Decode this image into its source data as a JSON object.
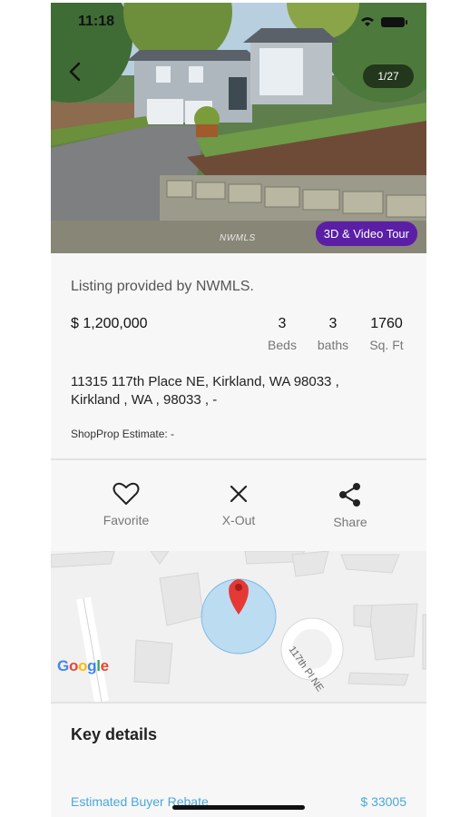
{
  "status_bar": {
    "time": "11:18"
  },
  "gallery": {
    "counter": "1/27",
    "tour_button": "3D & Video Tour",
    "watermark": "NWMLS"
  },
  "listing": {
    "provider": "Listing provided by NWMLS.",
    "price": "$ 1,200,000",
    "stats": [
      {
        "value": "3",
        "label": "Beds"
      },
      {
        "value": "3",
        "label": "baths"
      },
      {
        "value": "1760",
        "label": "Sq. Ft"
      }
    ],
    "address_line1": "11315 117th Place NE, Kirkland, WA 98033 ,",
    "address_line2": "Kirkland , WA , 98033 , -",
    "estimate": "ShopProp Estimate: -"
  },
  "actions": [
    {
      "label": "Favorite",
      "icon": "heart-icon"
    },
    {
      "label": "X-Out",
      "icon": "close-icon"
    },
    {
      "label": "Share",
      "icon": "share-icon"
    }
  ],
  "map": {
    "street_label": "117th Pl NE",
    "logo": "Google",
    "pin_color": "#e53935",
    "radius_color": "#a9d4f2"
  },
  "details": {
    "title": "Key details",
    "rebate_label": "Estimated Buyer Rebate",
    "rebate_value": "$ 33005"
  },
  "colors": {
    "accent": "#5b1fa6",
    "link": "#4aa8d8"
  }
}
